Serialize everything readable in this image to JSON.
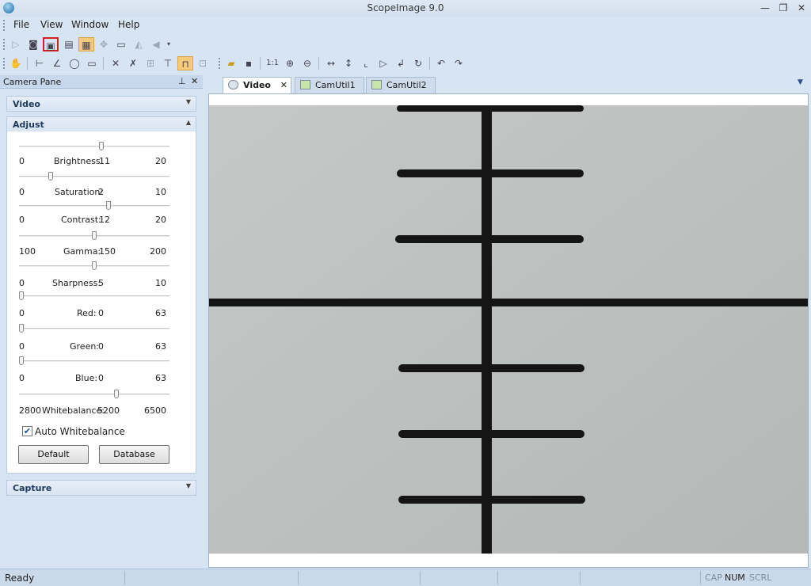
{
  "window": {
    "title": "ScopeImage 9.0"
  },
  "menu": [
    "File",
    "View",
    "Window",
    "Help"
  ],
  "pane": {
    "title": "Camera Pane",
    "groups": {
      "video": "Video",
      "adjust": "Adjust",
      "capture": "Capture"
    },
    "sliders": [
      {
        "name": "Brightness",
        "label": "Brightness:",
        "min": "0",
        "max": "20",
        "value": "11",
        "level": 0.55
      },
      {
        "name": "Saturation",
        "label": "Saturation:",
        "min": "0",
        "max": "10",
        "value": "2",
        "level": 0.2
      },
      {
        "name": "Contrast",
        "label": "Contrast:",
        "min": "0",
        "max": "20",
        "value": "12",
        "level": 0.6
      },
      {
        "name": "Gamma",
        "label": "Gamma:",
        "min": "100",
        "max": "200",
        "value": "150",
        "level": 0.5
      },
      {
        "name": "Sharpness",
        "label": "Sharpness:",
        "min": "0",
        "max": "10",
        "value": "5",
        "level": 0.5
      },
      {
        "name": "Red",
        "label": "Red:",
        "min": "0",
        "max": "63",
        "value": "0",
        "level": 0.0
      },
      {
        "name": "Green",
        "label": "Green:",
        "min": "0",
        "max": "63",
        "value": "0",
        "level": 0.0
      },
      {
        "name": "Blue",
        "label": "Blue:",
        "min": "0",
        "max": "63",
        "value": "0",
        "level": 0.0
      },
      {
        "name": "Whitebalance",
        "label": "Whitebalance:",
        "min": "2800",
        "max": "6500",
        "value": "5200",
        "level": 0.65
      }
    ],
    "auto_whitebalance": {
      "label": "Auto Whitebalance",
      "checked": true
    },
    "buttons": {
      "default": "Default",
      "database": "Database"
    }
  },
  "tabs": [
    {
      "label": "Video",
      "active": true,
      "closable": true,
      "icon": "camera-icon"
    },
    {
      "label": "CamUtil1",
      "active": false,
      "icon": "image-icon"
    },
    {
      "label": "CamUtil2",
      "active": false,
      "icon": "image-icon"
    }
  ],
  "status": {
    "text": "Ready",
    "indicators": [
      "CAP",
      "NUM",
      "SCRL"
    ]
  },
  "colors": {
    "accent": "#f7c97b",
    "highlight": "#d12020",
    "scale_line": "#141414"
  }
}
